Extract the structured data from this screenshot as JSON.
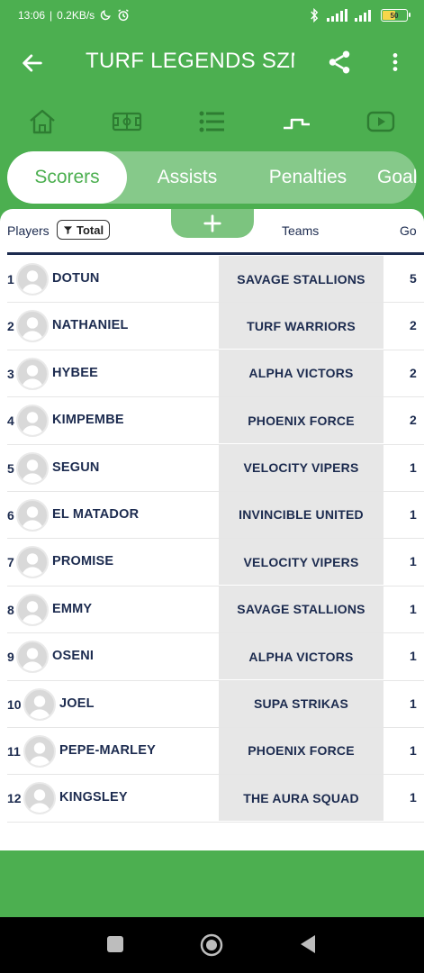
{
  "status": {
    "time": "13:06",
    "speed": "0.2KB/s",
    "battery": "50"
  },
  "app": {
    "title": "TURF LEGENDS SZN"
  },
  "tabs": [
    {
      "label": "Scorers",
      "active": true
    },
    {
      "label": "Assists",
      "active": false
    },
    {
      "label": "Penalties",
      "active": false
    },
    {
      "label": "Goal",
      "active": false
    }
  ],
  "table": {
    "headers": {
      "players": "Players",
      "filter": "Total",
      "teams": "Teams",
      "goals": "Go"
    },
    "rows": [
      {
        "rank": "1",
        "name": "DOTUN",
        "team": "SAVAGE STALLIONS",
        "goals": "5"
      },
      {
        "rank": "2",
        "name": "NATHANIEL",
        "team": "TURF WARRIORS",
        "goals": "2"
      },
      {
        "rank": "3",
        "name": "HYBEE",
        "team": "ALPHA VICTORS",
        "goals": "2"
      },
      {
        "rank": "4",
        "name": "KIMPEMBE",
        "team": "PHOENIX FORCE",
        "goals": "2"
      },
      {
        "rank": "5",
        "name": "SEGUN",
        "team": "VELOCITY VIPERS",
        "goals": "1"
      },
      {
        "rank": "6",
        "name": "EL MATADOR",
        "team": "INVINCIBLE UNITED",
        "goals": "1"
      },
      {
        "rank": "7",
        "name": "PROMISE",
        "team": "VELOCITY VIPERS",
        "goals": "1"
      },
      {
        "rank": "8",
        "name": "EMMY",
        "team": "SAVAGE STALLIONS",
        "goals": "1"
      },
      {
        "rank": "9",
        "name": "OSENI",
        "team": "ALPHA VICTORS",
        "goals": "1"
      },
      {
        "rank": "10",
        "name": "JOEL",
        "team": "SUPA STRIKAS",
        "goals": "1"
      },
      {
        "rank": "11",
        "name": "PEPE-MARLEY",
        "team": "PHOENIX FORCE",
        "goals": "1"
      },
      {
        "rank": "12",
        "name": "KINGSLEY",
        "team": "THE AURA SQUAD",
        "goals": "1"
      }
    ]
  },
  "icons": {
    "nav": [
      "home-icon",
      "pitch-icon",
      "list-icon",
      "bracket-icon",
      "video-icon"
    ],
    "app_bar": [
      "back-arrow-icon",
      "share-icon",
      "more-vertical-icon"
    ]
  },
  "colors": {
    "primary": "#4caf50",
    "tab_track": "#86c98a",
    "text_dark": "#1c2b4f",
    "team_cell": "#e7e7e7"
  }
}
